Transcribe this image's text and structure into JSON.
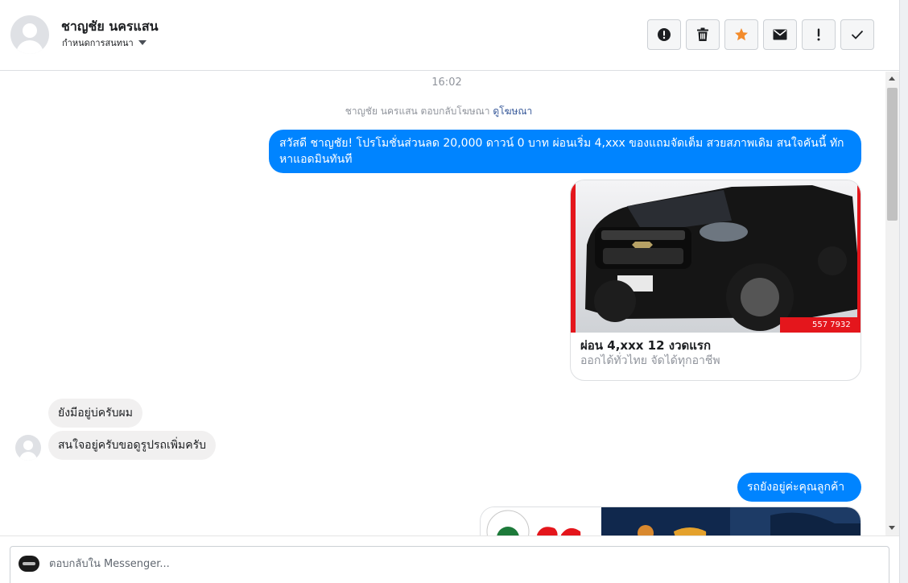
{
  "header": {
    "contact_name": "ชาญชัย นครแสน",
    "assign_label": "กำหนดการสนทนา",
    "actions": [
      {
        "icon": "alert-circle-icon",
        "label": ""
      },
      {
        "icon": "trash-icon",
        "label": ""
      },
      {
        "icon": "star-icon",
        "label": ""
      },
      {
        "icon": "envelope-icon",
        "label": ""
      },
      {
        "icon": "exclamation-icon",
        "label": ""
      },
      {
        "icon": "checkmark-icon",
        "label": ""
      }
    ],
    "star_color": "#f38b2b"
  },
  "conversation": {
    "timestamp": "16:02",
    "reply_note_prefix": "ชาญชัย นครแสน ตอบกลับโฆษณา",
    "reply_note_link": "ดูโฆษณา",
    "messages": [
      {
        "from": "page",
        "text": "สวัสดี ชาญชัย! โปรโมชั่นส่วนลด 20,000 ดาวน์ 0 บาท ผ่อนเริ่ม 4,xxx  ของแถมจัดเต็ม สวยสภาพเดิม สนใจคันนี้ ทักหาแอดมินทันที"
      },
      {
        "from": "customer",
        "text": "ยังมีอยู่บ่ครับผม"
      },
      {
        "from": "customer",
        "text": "สนใจอยู่ครับขอดูรูปรถเพิ่มครับ"
      },
      {
        "from": "page",
        "text": "รถยังอยู่ค่ะคุณลูกค้า"
      }
    ],
    "ad_card": {
      "title": "ผ่อน 4,xxx 12 งวดแรก",
      "subtitle": "ออกได้ทั่วไทย จัดได้ทุกอาชีพ",
      "image_phone_partial": "557 7932"
    },
    "bubble_color": "#0084ff"
  },
  "composer": {
    "placeholder": "ตอบกลับใน Messenger..."
  }
}
